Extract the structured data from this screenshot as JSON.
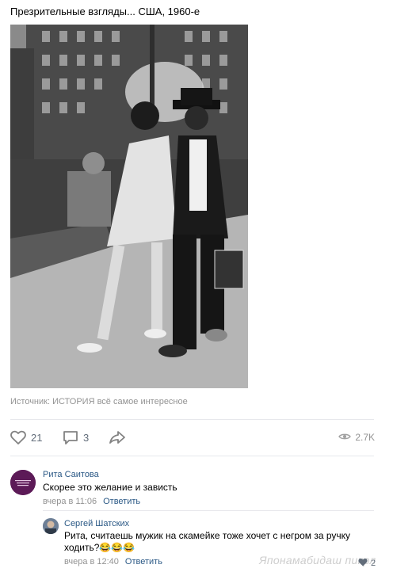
{
  "post": {
    "text": "Презрительные взгляды... США, 1960-е",
    "source": "Источник: ИСТОРИЯ всё самое интересное"
  },
  "actions": {
    "likes": "21",
    "comments": "3",
    "views": "2.7K"
  },
  "comments": [
    {
      "author": "Рита Саитова",
      "text": "Скорее это желание и зависть",
      "time": "вчера в 11:06",
      "reply": "Ответить"
    },
    {
      "author": "Сергей Шатских",
      "text_line1": "Рита, считаешь мужик на скамейке тоже хочет с негром за ручку",
      "text_line2": "ходить?😂😂😂",
      "time": "вчера в 12:40",
      "reply": "Ответить",
      "likes": "2"
    }
  ],
  "watermark": "Японамабидаш пикрл",
  "icons": {
    "like": "heart-icon",
    "comment": "comment-icon",
    "share": "share-arrow-icon",
    "views": "eye-icon"
  },
  "colors": {
    "link": "#2a5885",
    "muted": "#939393",
    "icon": "#828282"
  }
}
